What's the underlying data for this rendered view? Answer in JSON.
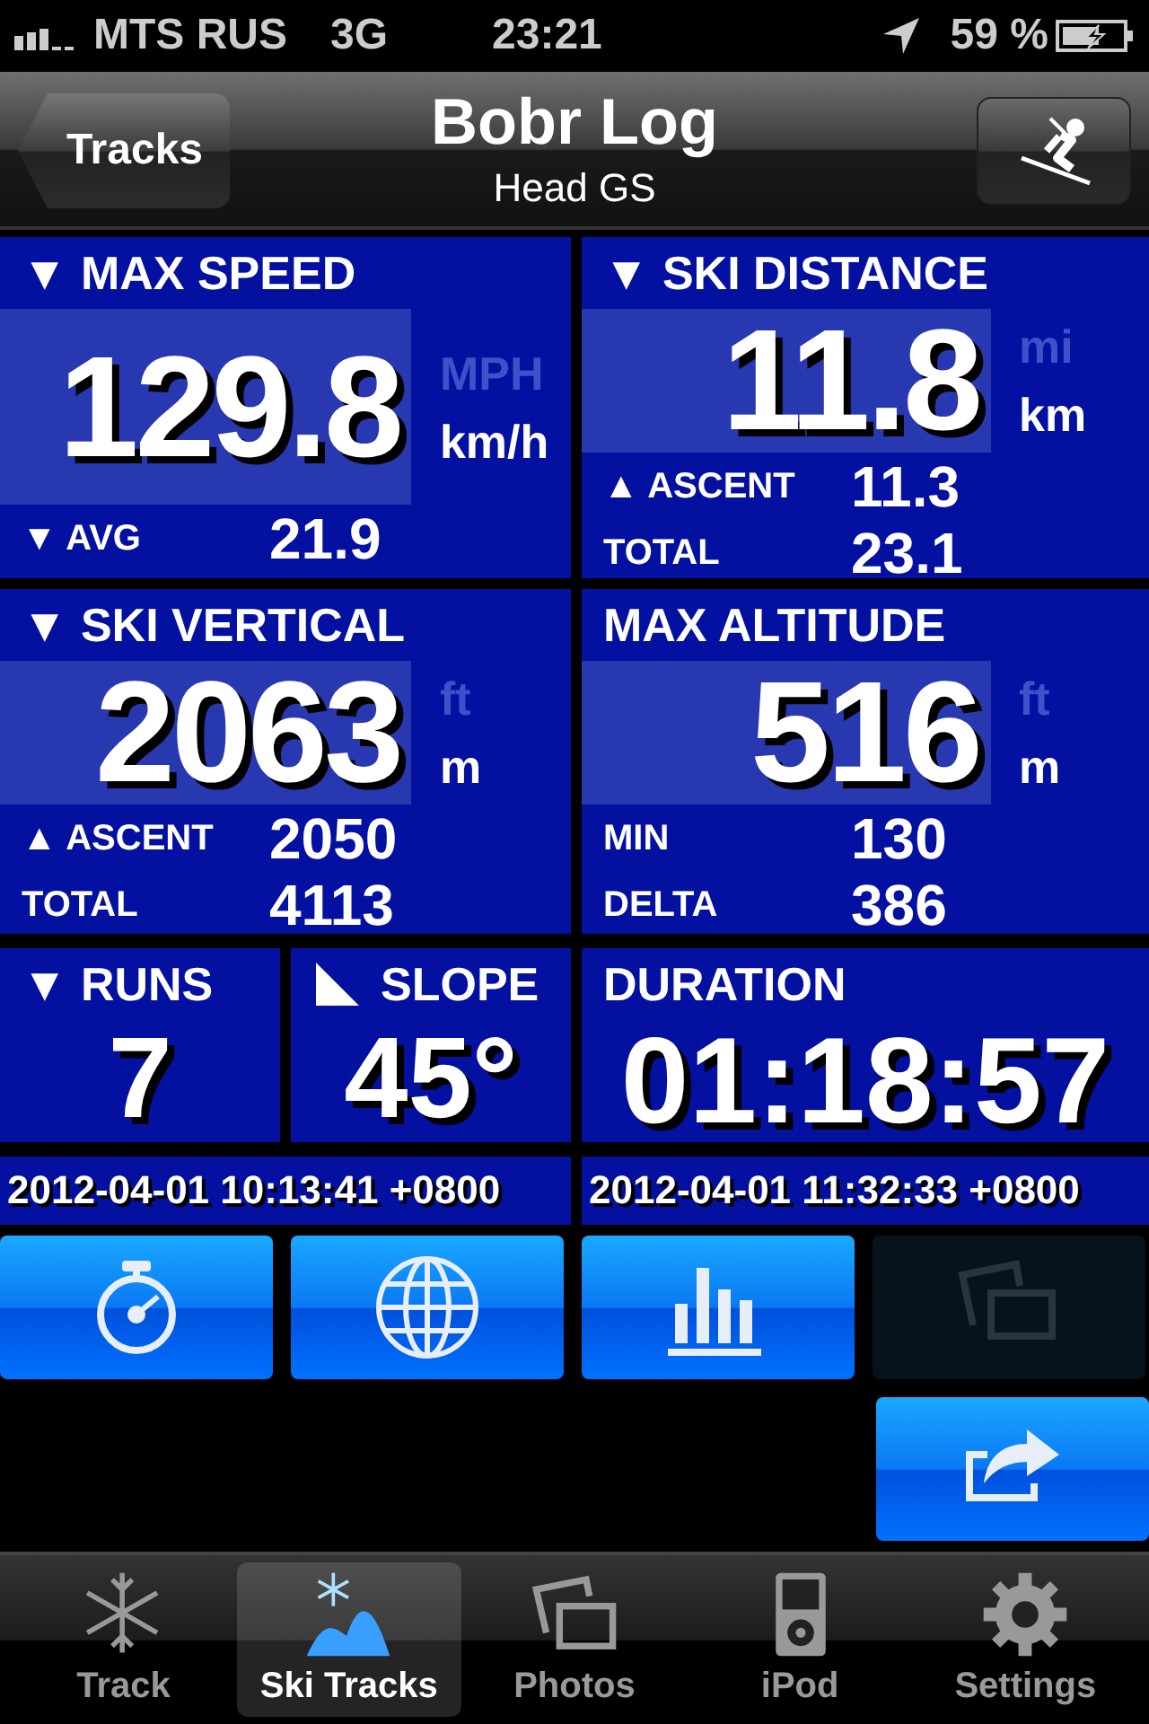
{
  "status_bar": {
    "carrier": "MTS RUS",
    "network": "3G",
    "time": "23:21",
    "battery": "59 %"
  },
  "nav": {
    "back_button": "Tracks",
    "title": "Bobr Log",
    "subtitle": "Head GS"
  },
  "panels": [
    {
      "title": "▼ MAX SPEED",
      "value": "129.8",
      "units": [
        {
          "label": "MPH",
          "selected": false
        },
        {
          "label": "km/h",
          "selected": true
        }
      ],
      "stats": [
        {
          "label": "▼ AVG",
          "value": "21.9"
        }
      ]
    },
    {
      "title": "▼ SKI DISTANCE",
      "value": "11.8",
      "units": [
        {
          "label": "mi",
          "selected": false
        },
        {
          "label": "km",
          "selected": true
        }
      ],
      "stats": [
        {
          "label": "▲ ASCENT",
          "value": "11.3"
        },
        {
          "label": "TOTAL",
          "value": "23.1"
        }
      ]
    },
    {
      "title": "▼ SKI VERTICAL",
      "value": "2063",
      "units": [
        {
          "label": "ft",
          "selected": false
        },
        {
          "label": "m",
          "selected": true
        }
      ],
      "stats": [
        {
          "label": "▲ ASCENT",
          "value": "2050"
        },
        {
          "label": "TOTAL",
          "value": "4113"
        }
      ]
    },
    {
      "title": "MAX ALTITUDE",
      "value": "516",
      "units": [
        {
          "label": "ft",
          "selected": false
        },
        {
          "label": "m",
          "selected": true
        }
      ],
      "stats": [
        {
          "label": "MIN",
          "value": "130"
        },
        {
          "label": "DELTA",
          "value": "386"
        }
      ]
    }
  ],
  "small_panels": [
    {
      "kind": "counter",
      "title": "▼ RUNS",
      "value": "7"
    },
    {
      "kind": "slope",
      "title": "SLOPE",
      "value": "45°"
    },
    {
      "kind": "duration",
      "title": "DURATION",
      "value": "01:18:57"
    }
  ],
  "dates": [
    "2012-04-01 10:13:41 +0800",
    "2012-04-01 11:32:33 +0800"
  ],
  "actions": [
    {
      "kind": "stopwatch",
      "disabled": false
    },
    {
      "kind": "globe",
      "disabled": false
    },
    {
      "kind": "chart",
      "disabled": false
    },
    {
      "kind": "photos",
      "disabled": true
    }
  ],
  "share_button": {
    "kind": "share",
    "disabled": false
  },
  "tabs": [
    {
      "kind": "snowflake",
      "label": "Track",
      "selected": false
    },
    {
      "kind": "mountain",
      "label": "Ski Tracks",
      "selected": true
    },
    {
      "kind": "photos",
      "label": "Photos",
      "selected": false
    },
    {
      "kind": "ipod",
      "label": "iPod",
      "selected": false
    },
    {
      "kind": "gear",
      "label": "Settings",
      "selected": false
    }
  ]
}
